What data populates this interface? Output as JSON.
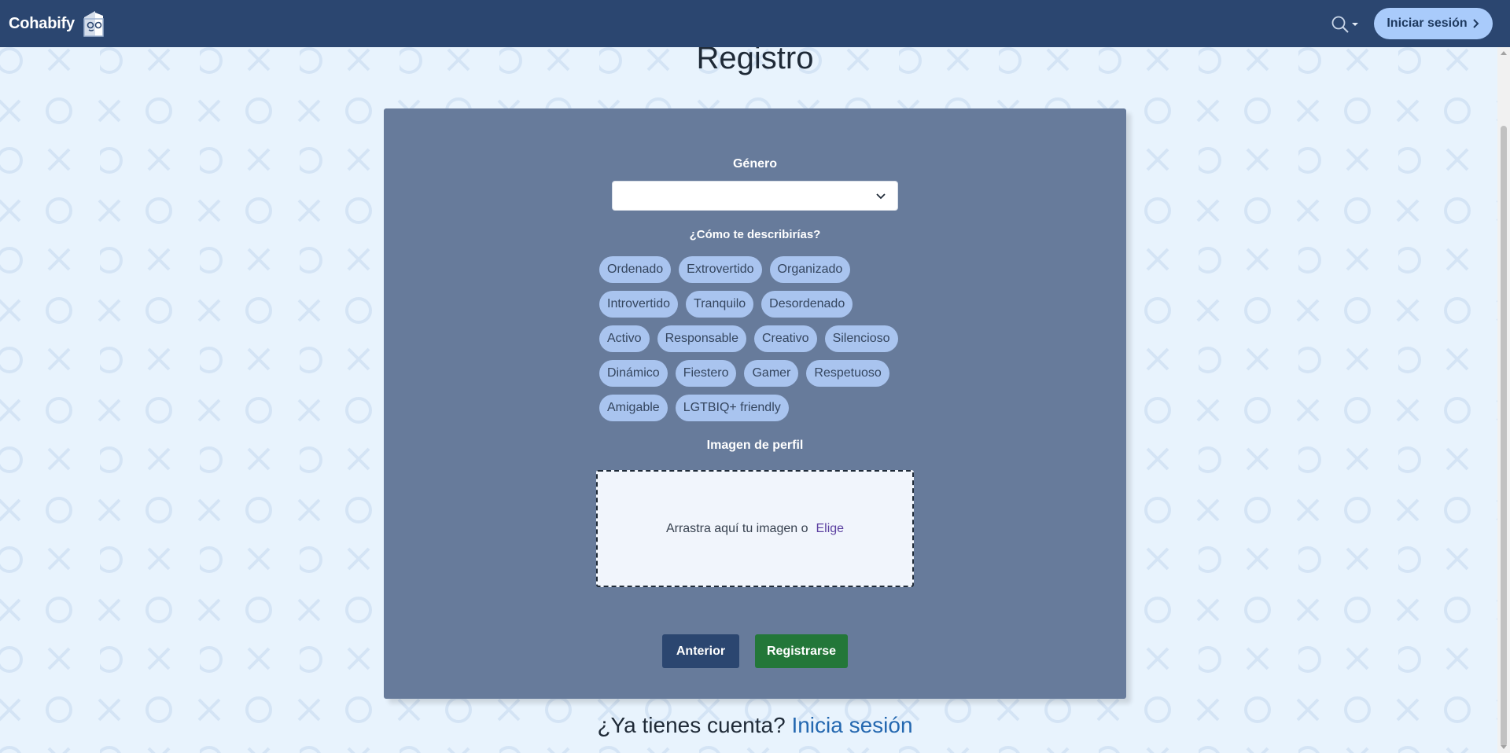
{
  "navbar": {
    "brand": "Cohabify",
    "login_label": "Iniciar sesión"
  },
  "page": {
    "title": "Registro"
  },
  "form": {
    "gender_label": "Género",
    "gender_value": "",
    "describe_label": "¿Cómo te describirías?",
    "tags": [
      [
        "Ordenado",
        "Extrovertido",
        "Organizado"
      ],
      [
        "Introvertido",
        "Tranquilo",
        "Desordenado"
      ],
      [
        "Activo",
        "Responsable",
        "Creativo",
        "Silencioso"
      ],
      [
        "Dinámico",
        "Fiestero",
        "Gamer",
        "Respetuoso"
      ],
      [
        "Amigable",
        "LGTBIQ+ friendly"
      ]
    ],
    "profile_image_label": "Imagen de perfil",
    "dropzone_text": "Arrastra aquí tu imagen o",
    "dropzone_choose": "Elige",
    "prev_button": "Anterior",
    "register_button": "Registrarse"
  },
  "footer": {
    "question": "¿Ya tienes cuenta?",
    "login_link": "Inicia sesión"
  },
  "colors": {
    "navbar": "#2b4670",
    "background": "#e8f3fd",
    "card": "#677b9b",
    "tag": "#a9c4ef",
    "register": "#237739",
    "login_button": "#a9cbfb",
    "link": "#2468b0"
  },
  "icons": {
    "brand": "house-logo-icon",
    "search": "search-icon",
    "caret": "caret-down-icon",
    "login_chevron": "chevron-right-icon",
    "select_chevron": "chevron-down-icon"
  }
}
